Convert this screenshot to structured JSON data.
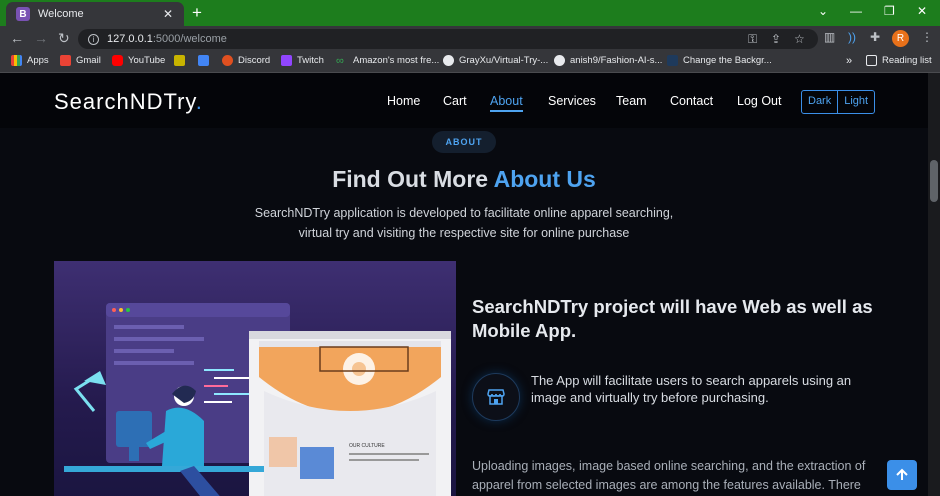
{
  "browser": {
    "tab_title": "Welcome",
    "tab_favicon": "B",
    "url_host": "127.0.0.1",
    "url_path": ":5000/welcome",
    "profile_initial": "R",
    "bookmarks": [
      "Apps",
      "Gmail",
      "YouTube",
      "Discord",
      "Twitch",
      "Amazon's most fre...",
      "GrayXu/Virtual-Try-...",
      "anish9/Fashion-AI-s...",
      "Change the Backgr..."
    ],
    "reading_list": "Reading list",
    "overflow": "»"
  },
  "site": {
    "logo": "SearchNDTry",
    "logo_dot": ".",
    "nav": [
      "Home",
      "Cart",
      "About",
      "Services",
      "Team",
      "Contact",
      "Log Out"
    ],
    "active_nav": "About",
    "theme_dark": "Dark",
    "theme_light": "Light"
  },
  "about": {
    "pill": "ABOUT",
    "heading_plain": "Find Out More ",
    "heading_accent": "About Us",
    "subtitle": "SearchNDTry application is developed to facilitate online apparel searching, virtual try and visiting the respective site for online purchase",
    "feature_title": "SearchNDTry project will have Web as well as Mobile App.",
    "feature_text": "The App will facilitate users to search apparels using an image and virtually try before purchasing.",
    "body_text": "Uploading images, image based online searching, and the extraction of apparel from selected images are among the features available. There",
    "illustration_caption": "OUR CULTURE"
  },
  "colors": {
    "accent": "#4ea3f0",
    "page_bg": "#080a10",
    "tabstrip": "#1d7d1d"
  },
  "icons": {
    "feature": "store-icon",
    "back_to_top": "arrow-up-icon"
  }
}
